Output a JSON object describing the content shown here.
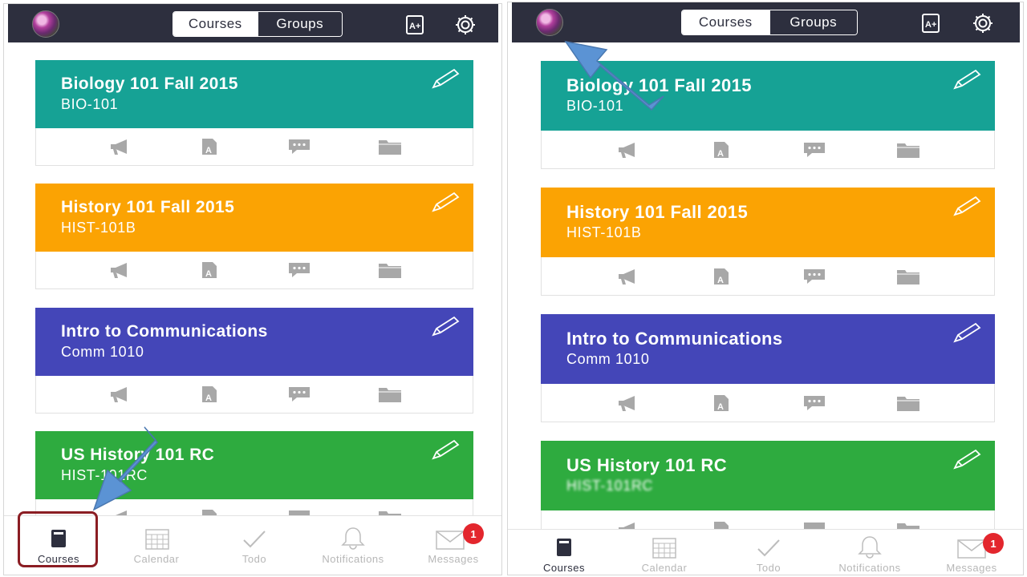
{
  "segments": {
    "courses": "Courses",
    "groups": "Groups"
  },
  "courses": [
    {
      "name": "Biology 101 Fall 2015",
      "code": "BIO-101",
      "color": "#16a295"
    },
    {
      "name": "History 101 Fall 2015",
      "code": "HIST-101B",
      "color": "#fba303"
    },
    {
      "name": "Intro to Communications",
      "code": "Comm 1010",
      "color": "#4446b8"
    },
    {
      "name": "US History 101 RC",
      "code": "HIST-101RC",
      "color": "#2eab3f"
    }
  ],
  "tabs": {
    "courses": "Courses",
    "calendar": "Calendar",
    "todo": "Todo",
    "notifications": "Notifications",
    "messages": "Messages",
    "messages_badge": "1"
  },
  "colors": {
    "topbar": "#2d2f3e",
    "highlight": "#8b1d23",
    "arrow": "#5b93d4",
    "badge": "#e3262d"
  },
  "icons": [
    "announcements-icon",
    "assignments-icon",
    "discussions-icon",
    "files-icon",
    "edit-icon",
    "grades-icon",
    "gear-icon",
    "courses-tab-icon",
    "calendar-icon",
    "todo-icon",
    "notifications-icon",
    "messages-icon"
  ]
}
